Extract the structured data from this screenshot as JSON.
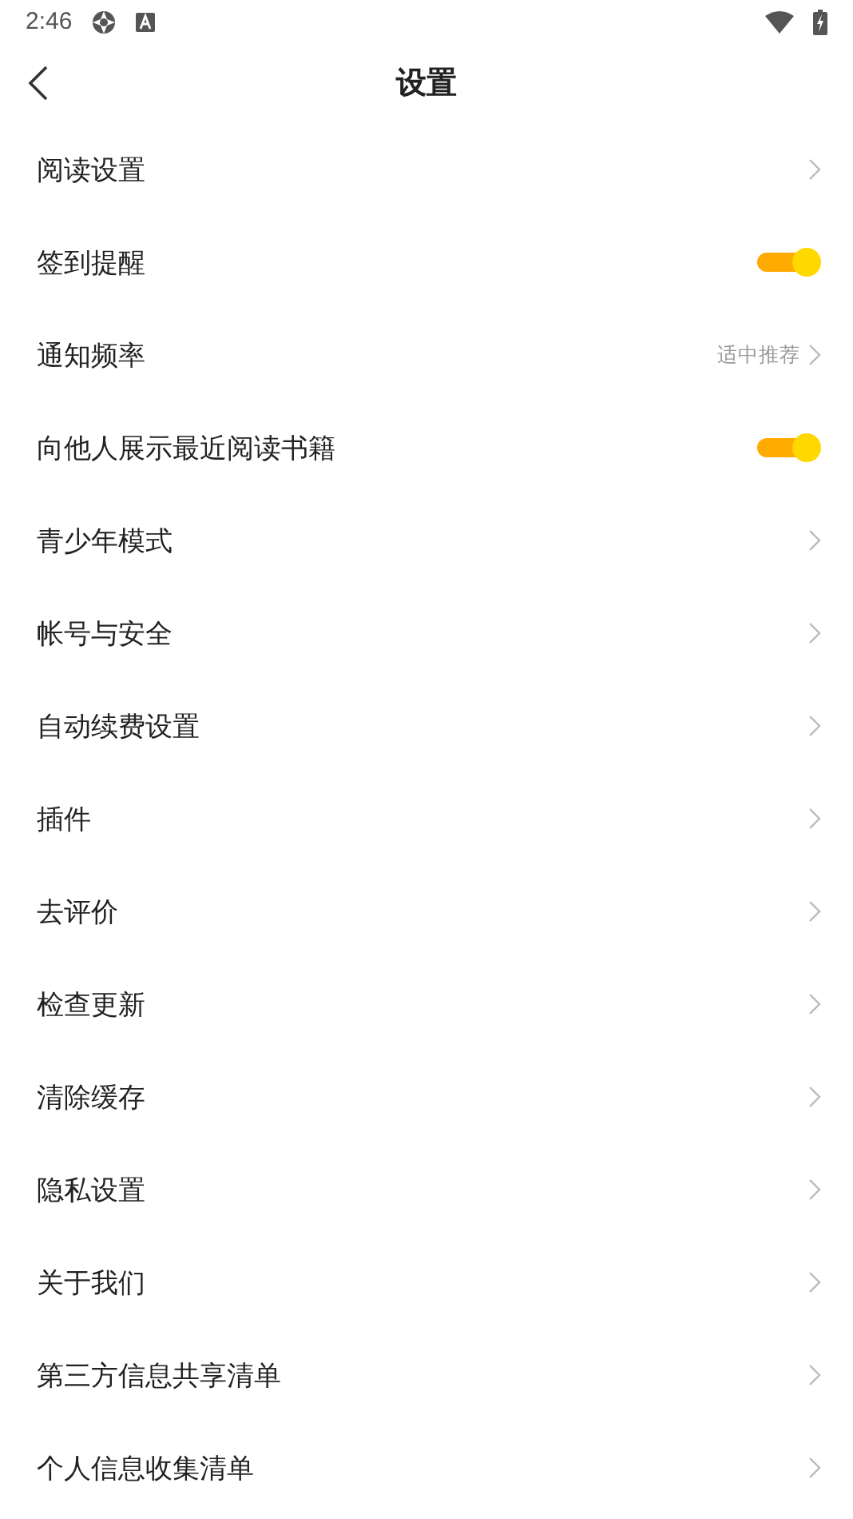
{
  "status_bar": {
    "time": "2:46"
  },
  "header": {
    "title": "设置"
  },
  "items": [
    {
      "kind": "link",
      "label": "阅读设置"
    },
    {
      "kind": "toggle",
      "label": "签到提醒",
      "on": true
    },
    {
      "kind": "value",
      "label": "通知频率",
      "value": "适中推荐"
    },
    {
      "kind": "toggle",
      "label": "向他人展示最近阅读书籍",
      "on": true
    },
    {
      "kind": "link",
      "label": "青少年模式"
    },
    {
      "kind": "link",
      "label": "帐号与安全"
    },
    {
      "kind": "link",
      "label": "自动续费设置"
    },
    {
      "kind": "link",
      "label": "插件"
    },
    {
      "kind": "link",
      "label": "去评价"
    },
    {
      "kind": "link",
      "label": "检查更新"
    },
    {
      "kind": "link",
      "label": "清除缓存"
    },
    {
      "kind": "link",
      "label": "隐私设置"
    },
    {
      "kind": "link",
      "label": "关于我们"
    },
    {
      "kind": "link",
      "label": "第三方信息共享清单"
    },
    {
      "kind": "link",
      "label": "个人信息收集清单"
    }
  ]
}
